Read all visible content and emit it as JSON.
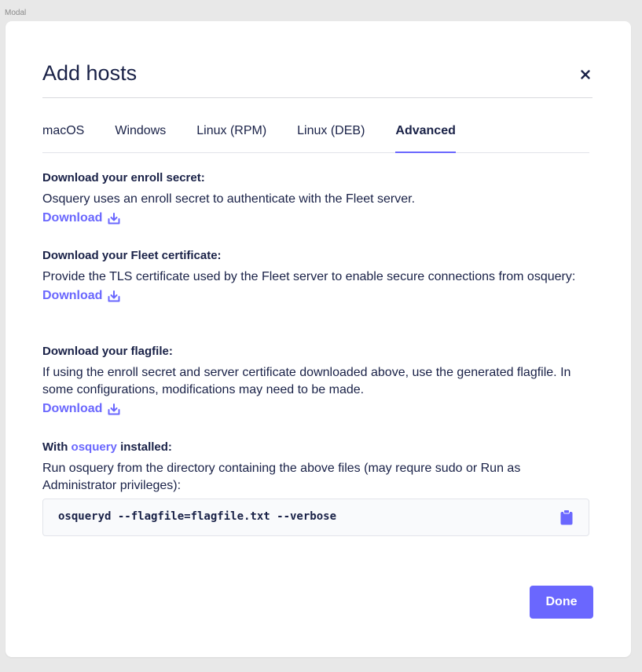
{
  "frame_label": "Modal",
  "modal": {
    "title": "Add hosts",
    "close_icon": "close-icon"
  },
  "tabs": [
    {
      "label": "macOS",
      "active": false
    },
    {
      "label": "Windows",
      "active": false
    },
    {
      "label": "Linux (RPM)",
      "active": false
    },
    {
      "label": "Linux (DEB)",
      "active": false
    },
    {
      "label": "Advanced",
      "active": true
    }
  ],
  "sections": {
    "enroll_secret": {
      "title": "Download your enroll secret:",
      "description": "Osquery uses an enroll secret to authenticate with the Fleet server.",
      "link": "Download",
      "icon": "download-icon"
    },
    "certificate": {
      "title": "Download your Fleet certificate:",
      "description": "Provide the TLS certificate used by the Fleet server to enable secure connections from osquery:",
      "link": "Download",
      "icon": "download-icon"
    },
    "flagfile": {
      "title": "Download your flagfile:",
      "description": "If using the enroll secret and server certificate downloaded above, use the generated flagfile. In some configurations, modifications may need to be made.",
      "link": "Download",
      "icon": "download-icon"
    },
    "installed": {
      "title_prefix": "With",
      "title_link": "osquery",
      "title_suffix": "installed:",
      "description": "Run osquery from the directory containing the above files (may requre sudo or Run as Administrator privileges):",
      "command": "osqueryd --flagfile=flagfile.txt --verbose",
      "copy_icon": "clipboard-icon"
    }
  },
  "footer": {
    "done_label": "Done"
  },
  "colors": {
    "accent": "#6a67fe",
    "text": "#192147",
    "border": "#e2e4ea",
    "code_bg": "#f9fafc"
  }
}
